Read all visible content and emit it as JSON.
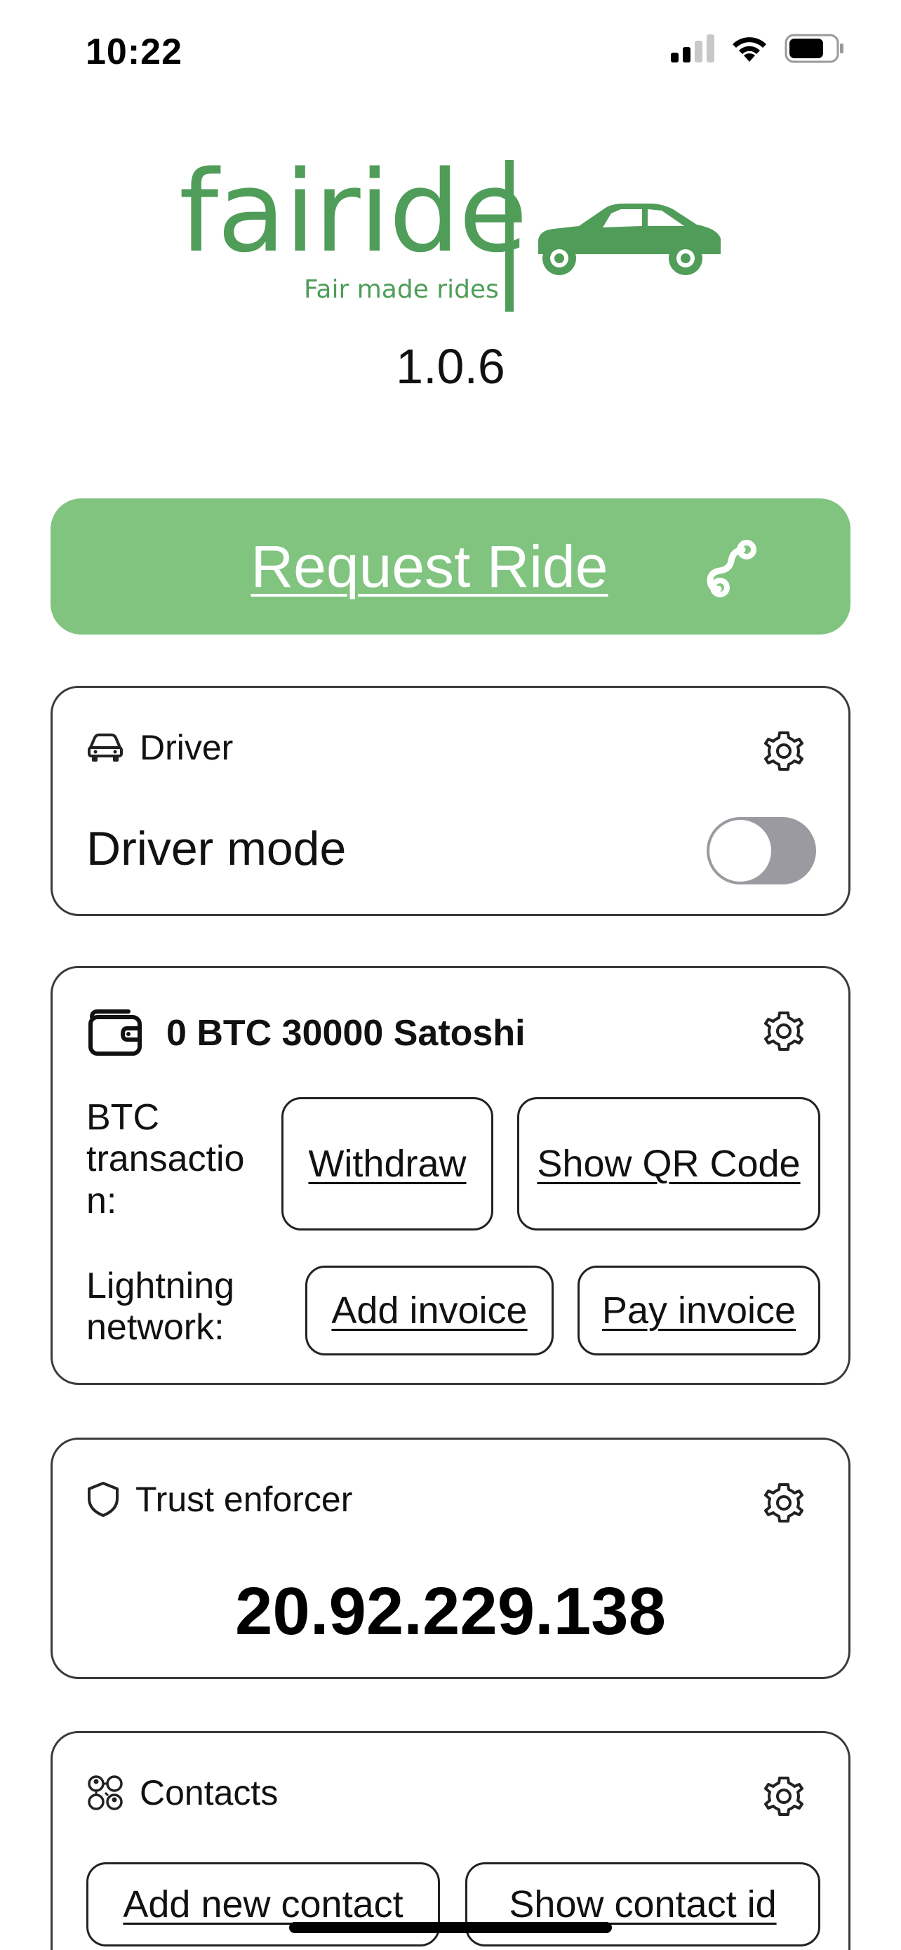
{
  "status_bar": {
    "time": "10:22"
  },
  "logo": {
    "word": "fairide",
    "tagline": "Fair made rides"
  },
  "version": "1.0.6",
  "request_ride": {
    "label": "Request Ride",
    "icon": "route-icon"
  },
  "driver": {
    "title": "Driver",
    "mode_label": "Driver mode",
    "mode_enabled": false
  },
  "wallet": {
    "balance": "0 BTC 30000 Satoshi",
    "btc_label": "BTC\ntransactio\nn:",
    "withdraw": "Withdraw",
    "show_qr": "Show QR Code",
    "lightning_label": "Lightning\nnetwork:",
    "add_invoice": "Add invoice",
    "pay_invoice": "Pay invoice"
  },
  "trust": {
    "title": "Trust enforcer",
    "ip": "20.92.229.138"
  },
  "contacts": {
    "title": "Contacts",
    "add_new": "Add new contact",
    "show_id": "Show contact id"
  },
  "colors": {
    "brand_green": "#4f9d59",
    "button_green": "#80c480",
    "toggle_off": "#9a9aa0"
  }
}
